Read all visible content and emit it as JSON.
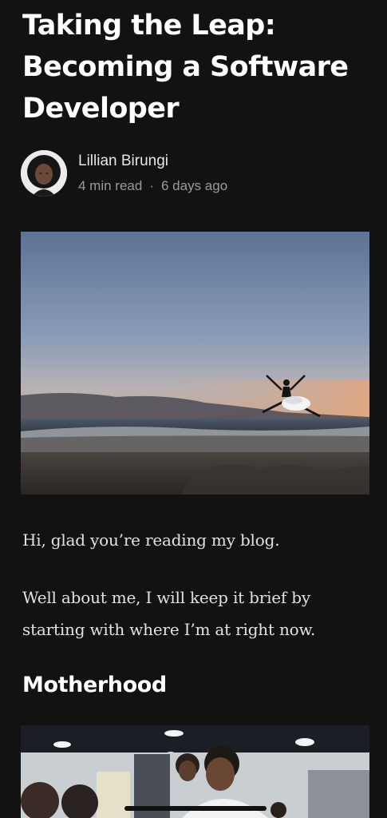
{
  "article": {
    "title": "Taking the Leap: Becoming a Software Developer",
    "author": {
      "name": "Lillian Birungi",
      "read_time": "4 min read",
      "separator": "·",
      "posted": "6 days ago"
    },
    "paragraphs": [
      "Hi, glad you’re reading my blog.",
      "Well about me, I will keep it brief by starting with where I’m at right now."
    ],
    "section_heading": "Motherhood"
  },
  "colors": {
    "background": "#121212",
    "text": "#ffffff",
    "muted": "#9a9a9a"
  },
  "icons": [
    "avatar",
    "hero-photo",
    "office-photo"
  ]
}
